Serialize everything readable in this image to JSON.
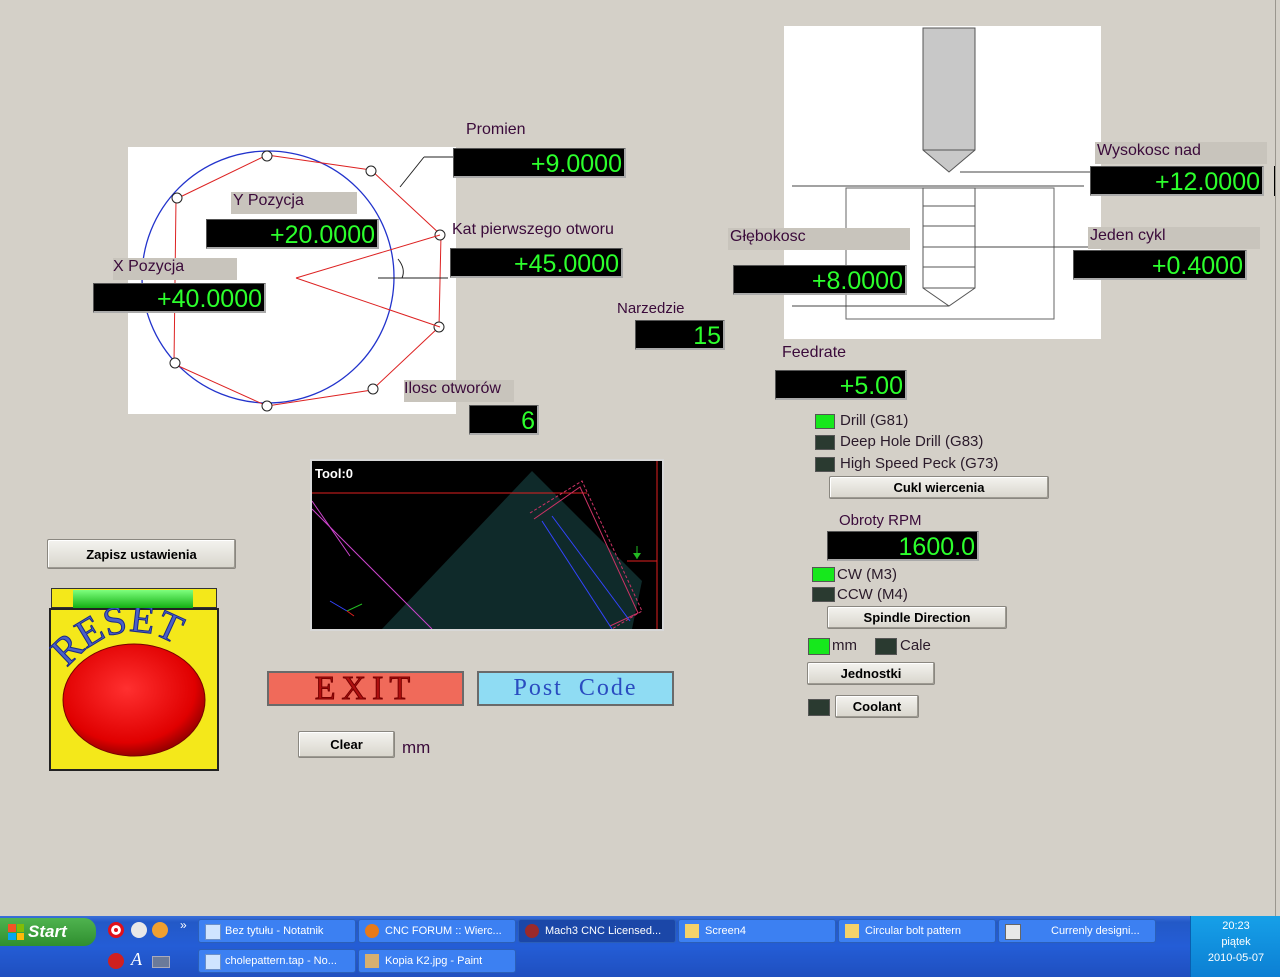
{
  "circle_panel": {
    "promien_label": "Promien",
    "promien_value": "+9.0000",
    "y_label": "Y Pozycja",
    "y_value": "+20.0000",
    "x_label": "X Pozycja",
    "x_value": "+40.0000",
    "kat_label": "Kat pierwszego otworu",
    "kat_value": "+45.0000",
    "ilosc_label": "Ilosc otworów",
    "ilosc_value": "6",
    "narzedzie_label": "Narzedzie",
    "narzedzie_value": "15"
  },
  "drill_panel": {
    "wysokosc_label": "Wysokosc nad",
    "wysokosc_value": "+12.0000",
    "glebokosc_label": "Głębokosc",
    "glebokosc_value": "+8.0000",
    "jeden_cykl_label": "Jeden cykl",
    "jeden_cykl_value": "+0.4000",
    "feedrate_label": "Feedrate",
    "feedrate_value": "+5.00"
  },
  "cycle": {
    "options": [
      {
        "label": "Drill (G81)",
        "state": "on"
      },
      {
        "label": "Deep Hole Drill (G83)",
        "state": "off"
      },
      {
        "label": "High Speed Peck (G73)",
        "state": "off"
      }
    ],
    "button": "Cukl wiercenia"
  },
  "spindle": {
    "rpm_label": "Obroty RPM",
    "rpm_value": "1600.0",
    "cw_label": "CW (M3)",
    "ccw_label": "CCW (M4)",
    "direction_button": "Spindle Direction"
  },
  "units": {
    "mm_label": "mm",
    "cale_label": "Cale",
    "button": "Jednostki"
  },
  "coolant_button": "Coolant",
  "toolpath": {
    "tool_label": "Tool:0"
  },
  "buttons": {
    "zapisz": "Zapisz ustawienia",
    "exit": "EXIT",
    "post_code": "Post  Code",
    "clear": "Clear",
    "clear_unit": "mm"
  },
  "reset": {
    "text": "RESET"
  },
  "taskbar": {
    "start": "Start",
    "tasks_row1": [
      {
        "label": "Bez tytułu - Notatnik",
        "icon": "notepad-icon"
      },
      {
        "label": "CNC FORUM :: Wierc...",
        "icon": "firefox-icon"
      },
      {
        "label": "Mach3 CNC  Licensed...",
        "icon": "mach3-icon"
      },
      {
        "label": "Screen4",
        "icon": "folder-icon"
      },
      {
        "label": "Circular bolt pattern",
        "icon": "folder-icon"
      },
      {
        "label": "Currenly designi...",
        "icon": "screen-designer-icon"
      }
    ],
    "tasks_row2": [
      {
        "label": "cholepattern.tap - No...",
        "icon": "notepad-icon"
      },
      {
        "label": "Kopia K2.jpg - Paint",
        "icon": "paint-icon"
      }
    ],
    "clock_time": "20:23",
    "clock_day": "piątek",
    "clock_date": "2010-05-07"
  },
  "colors": {
    "dro_text": "#2cff2c",
    "led_on": "#16e81c",
    "led_off": "#2a3a30",
    "exit_bg": "#f06a5a",
    "post_code_bg": "#8fdcf3"
  }
}
